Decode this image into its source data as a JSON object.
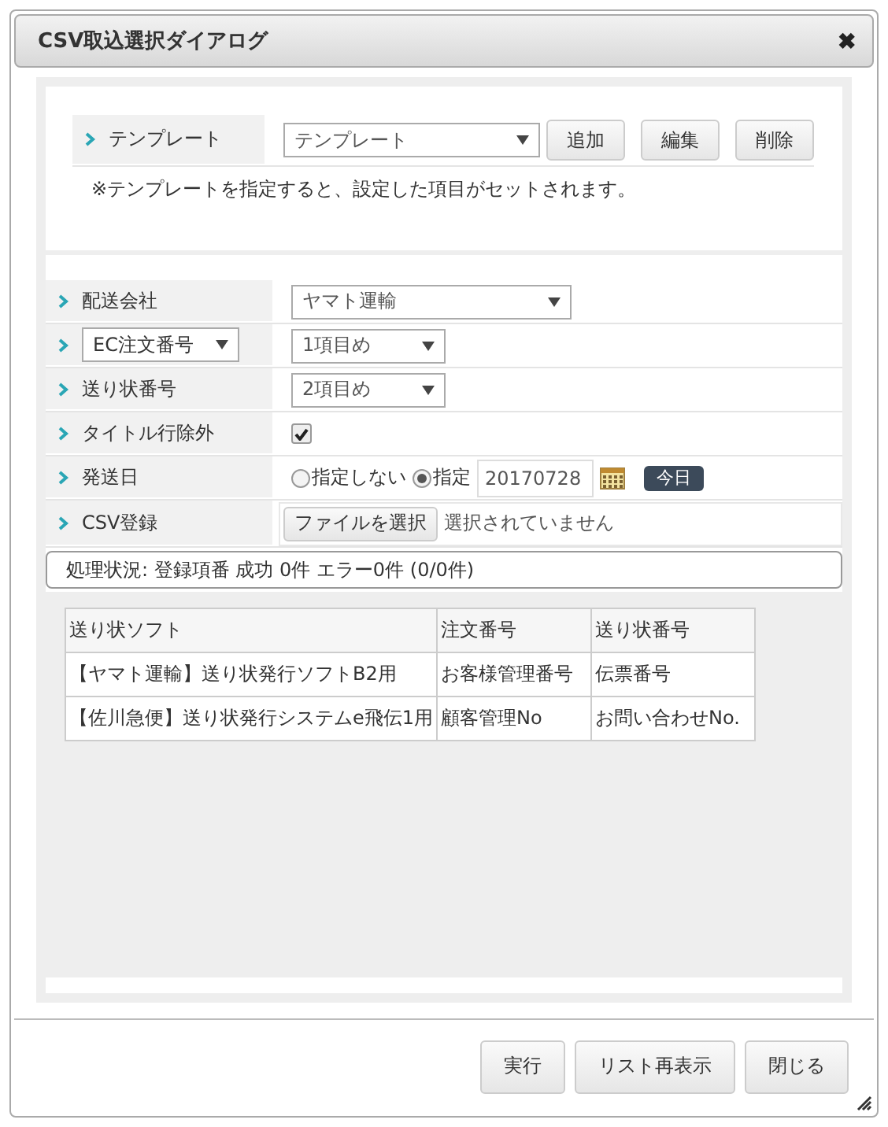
{
  "window": {
    "title": "CSV取込選択ダイアログ",
    "close": "✖"
  },
  "template": {
    "label": "テンプレート",
    "value": "テンプレート",
    "buttons": [
      "追加",
      "編集",
      "削除"
    ],
    "note": "※テンプレートを指定すると、設定した項目がセットされます。"
  },
  "rows": [
    {
      "kind": "wide-select",
      "label": "配送会社",
      "value": "ヤマト運輸"
    },
    {
      "kind": "label-select",
      "label": "EC注文番号",
      "value": "1項目め"
    },
    {
      "kind": "select",
      "label": "送り状番号",
      "value": "2項目め"
    },
    {
      "kind": "checkbox",
      "label": "タイトル行除外",
      "checked": true
    },
    {
      "kind": "date",
      "label": "発送日",
      "options": [
        {
          "label": "指定しない",
          "selected": false
        },
        {
          "label": "指定",
          "selected": true
        }
      ],
      "value": "20170728",
      "today": "今日"
    },
    {
      "kind": "file",
      "label": "CSV登録",
      "button": "ファイルを選択",
      "value": "選択されていません"
    }
  ],
  "status": "処理状況: 登録項番 成功 0件 エラー0件 (0/0件)",
  "table": {
    "columns": [
      "送り状ソフト",
      "注文番号",
      "送り状番号"
    ],
    "rows": [
      [
        "【ヤマト運輸】送り状発行ソフトB2用",
        "お客様管理番号",
        "伝票番号"
      ],
      [
        "【佐川急便】送り状発行システムe飛伝1用",
        "顧客管理No",
        "お問い合わせNo."
      ]
    ]
  },
  "buttons": [
    "実行",
    "リスト再表示",
    "閉じる"
  ]
}
